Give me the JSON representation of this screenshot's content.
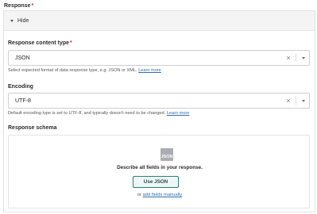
{
  "response": {
    "label": "Response",
    "required_mark": "*",
    "toggle_label": "Hide"
  },
  "content_type": {
    "label": "Response content type",
    "required_mark": "*",
    "value": "JSON",
    "help_text": "Select expected format of data response type, e.g. JSON or XML.",
    "help_link": "Learn more"
  },
  "encoding": {
    "label": "Encoding",
    "value": "UTF-8",
    "help_text": "Default encoding type is set to UTF-8, and typically doesn't need to be changed.",
    "help_link": "Learn more"
  },
  "schema": {
    "label": "Response schema",
    "icon_text": "JSON",
    "describe_text": "Describe all fields in your response.",
    "button_label": "Use JSON",
    "or_text": "or",
    "add_link": "add fields manually"
  },
  "icons": {
    "toggle": "caret-down-icon",
    "clear": "close-icon",
    "dropdown": "chevron-down-icon",
    "schema": "json-file-icon"
  },
  "colors": {
    "required": "#d32f2f",
    "link": "#2f6fb3",
    "button_border": "#2f7d7b",
    "panel_header": "#f4f4f4"
  }
}
